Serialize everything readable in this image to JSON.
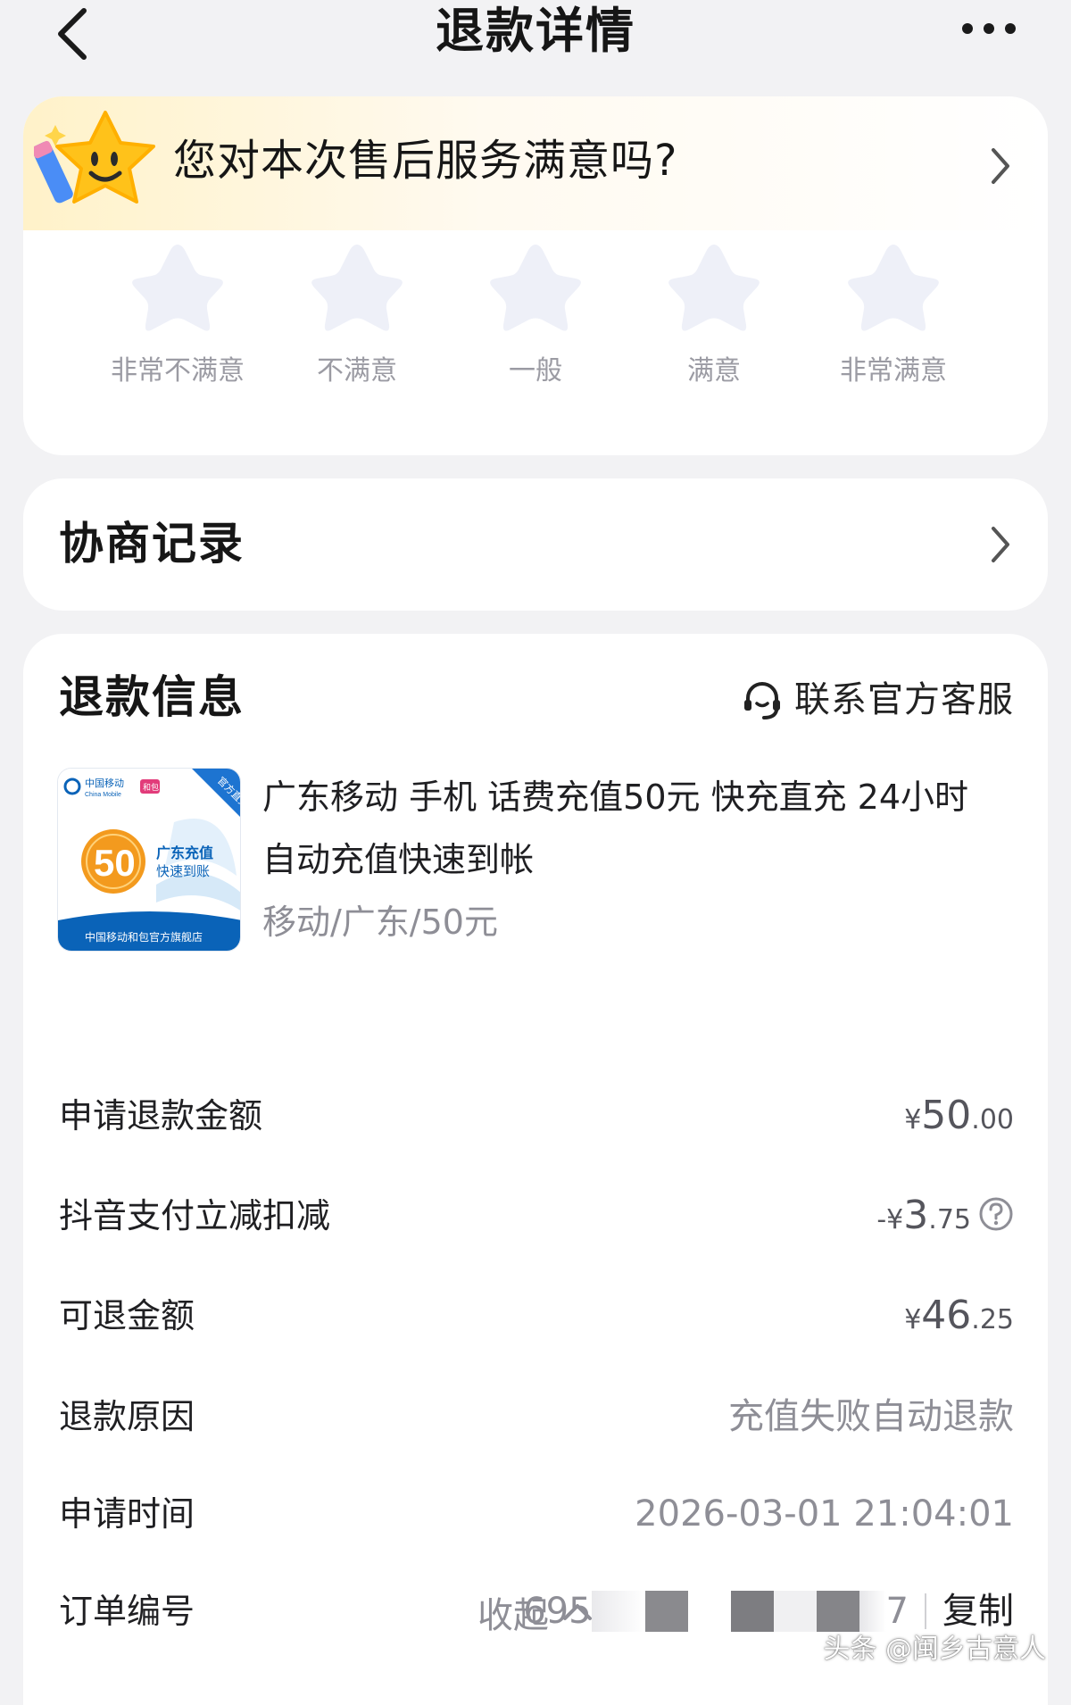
{
  "header": {
    "title": "退款详情",
    "back_icon": "chevron-left-icon",
    "more_icon": "more-dots-icon"
  },
  "survey": {
    "question": "您对本次售后服务满意吗?",
    "mascot_icon": "smiling-star-mascot-icon",
    "ratings": [
      "非常不满意",
      "不满意",
      "一般",
      "满意",
      "非常满意"
    ],
    "star_color": "#eef0f8"
  },
  "negotiation": {
    "title": "协商记录"
  },
  "refund_info": {
    "title": "退款信息",
    "contact_service": "联系官方客服",
    "product": {
      "title": "广东移动 手机 话费充值50元 快充直充 24小时 自动充值快速到帐",
      "spec": "移动/广东/50元",
      "thumb": {
        "brand": "中国移动",
        "brand_en": "China Mobile",
        "tag": "和包",
        "corner": "官方直充",
        "amount": "50",
        "line1": "广东充值",
        "line2": "快速到账",
        "footer": "中国移动和包官方旗舰店"
      }
    },
    "rows": {
      "apply_amount": {
        "label": "申请退款金额",
        "sym": "¥",
        "int": "50",
        "dec": ".00"
      },
      "discount": {
        "label": "抖音支付立减扣减",
        "sym": "-¥",
        "int": "3",
        "dec": ".75"
      },
      "refundable": {
        "label": "可退金额",
        "sym": "¥",
        "int": "46",
        "dec": ".25"
      },
      "reason": {
        "label": "退款原因",
        "value": "充值失败自动退款"
      },
      "apply_time": {
        "label": "申请时间",
        "value": "2026-03-01 21:04:01"
      },
      "order_no": {
        "label": "订单编号",
        "visible_prefix": "695",
        "visible_suffix": "7",
        "copy": "复制"
      }
    },
    "collapse": "收起"
  },
  "watermark": "头条 @闽乡古意人",
  "colors": {
    "background": "#f2f2f4",
    "card": "#ffffff",
    "survey_banner": "#fff2c9",
    "muted_text": "#8e8e96",
    "china_mobile_blue": "#0a63b8",
    "badge_orange": "#f39a1e"
  }
}
